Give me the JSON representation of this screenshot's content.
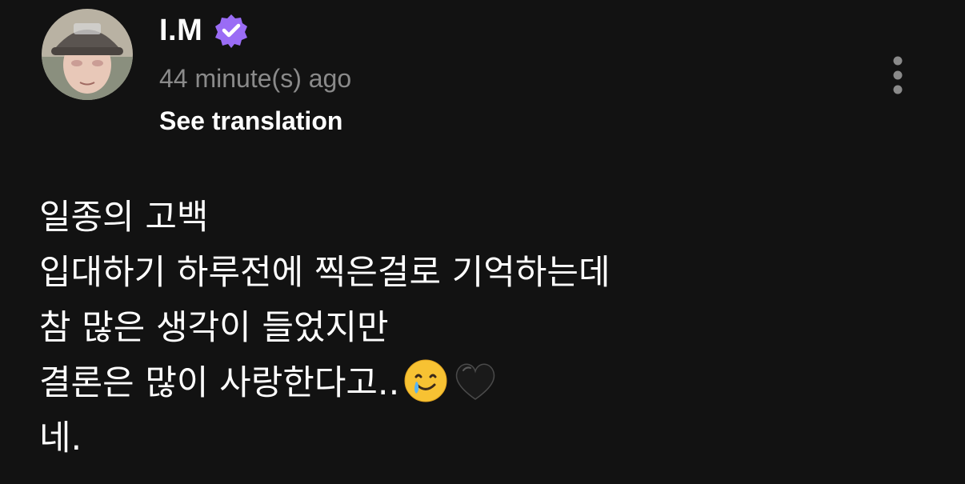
{
  "post": {
    "author": {
      "name": "I.M",
      "verified": true,
      "avatar_icon": "profile-photo-bucket-hat"
    },
    "timestamp": "44 minute(s) ago",
    "translate_label": "See translation",
    "more_icon": "vertical-ellipsis-icon",
    "body_lines": [
      "일종의 고백",
      "입대하기 하루전에 찍은걸로 기억하는데",
      "참 많은 생각이 들었지만",
      "결론은 많이 사랑한다고..",
      "네."
    ],
    "emojis": [
      "smiling-face-with-tear",
      "black-heart"
    ]
  },
  "colors": {
    "background": "#121212",
    "text_primary": "#ffffff",
    "text_secondary": "#8a8a8a",
    "verified_badge": "#9a6cf5"
  }
}
